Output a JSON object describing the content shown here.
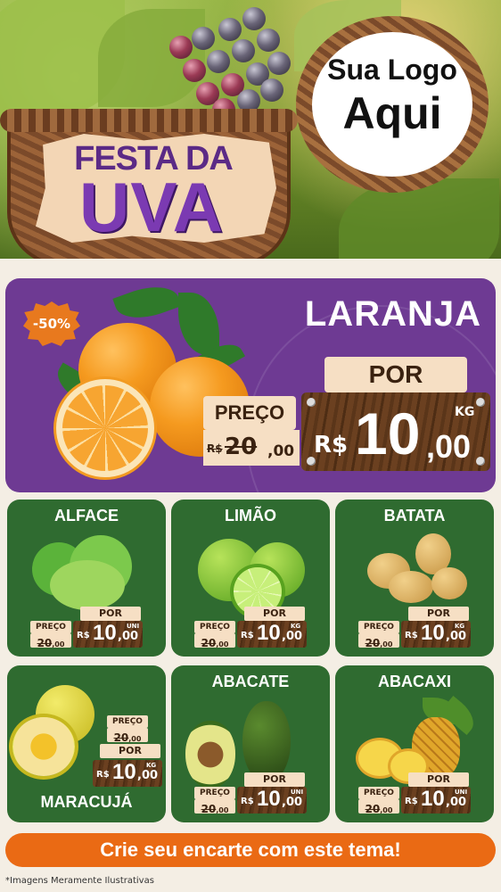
{
  "header": {
    "festival_line1": "FESTA DA",
    "festival_line2": "UVA",
    "logo_line1": "Sua Logo",
    "logo_line2": "Aqui"
  },
  "hero": {
    "product": "LARANJA",
    "discount_badge": "-50%",
    "preco_label": "PREÇO",
    "por_label": "POR",
    "old_price": {
      "currency": "R$",
      "integer": "20",
      "cents": ",00"
    },
    "new_price": {
      "currency": "R$",
      "integer": "10",
      "cents": ",00",
      "unit": "KG"
    }
  },
  "products": [
    {
      "name": "ALFACE",
      "preco_label": "PREÇO",
      "por_label": "POR",
      "old_integer": "20",
      "old_cents": ",00",
      "currency": "R$",
      "new_integer": "10",
      "new_cents": ",00",
      "unit": "UNI"
    },
    {
      "name": "LIMÃO",
      "preco_label": "PREÇO",
      "por_label": "POR",
      "old_integer": "20",
      "old_cents": ",00",
      "currency": "R$",
      "new_integer": "10",
      "new_cents": ",00",
      "unit": "KG"
    },
    {
      "name": "BATATA",
      "preco_label": "PREÇO",
      "por_label": "POR",
      "old_integer": "20",
      "old_cents": ",00",
      "currency": "R$",
      "new_integer": "10",
      "new_cents": ",00",
      "unit": "KG"
    },
    {
      "name": "MARACUJÁ",
      "preco_label": "PREÇO",
      "por_label": "POR",
      "old_integer": "20",
      "old_cents": ",00",
      "currency": "R$",
      "new_integer": "10",
      "new_cents": ",00",
      "unit": "KG"
    },
    {
      "name": "ABACATE",
      "preco_label": "PREÇO",
      "por_label": "POR",
      "old_integer": "20",
      "old_cents": ",00",
      "currency": "R$",
      "new_integer": "10",
      "new_cents": ",00",
      "unit": "UNI"
    },
    {
      "name": "ABACAXI",
      "preco_label": "PREÇO",
      "por_label": "POR",
      "old_integer": "20",
      "old_cents": ",00",
      "currency": "R$",
      "new_integer": "10",
      "new_cents": ",00",
      "unit": "UNI"
    }
  ],
  "footer": {
    "cta": "Crie seu encarte com este tema!",
    "disclaimer": "*Imagens Meramente Ilustrativas"
  },
  "icons": [
    "grape-cluster-icon",
    "basket-icon",
    "orange-icon",
    "lettuce-icon",
    "lime-icon",
    "potato-icon",
    "passion-fruit-icon",
    "avocado-icon",
    "pineapple-icon"
  ],
  "colors": {
    "hero_bg": "#6e3a93",
    "card_bg": "#2f6b30",
    "cta_bg": "#ea6a14",
    "title_purple": "#7b3ab2",
    "tag_cream": "#f6dfc4"
  }
}
